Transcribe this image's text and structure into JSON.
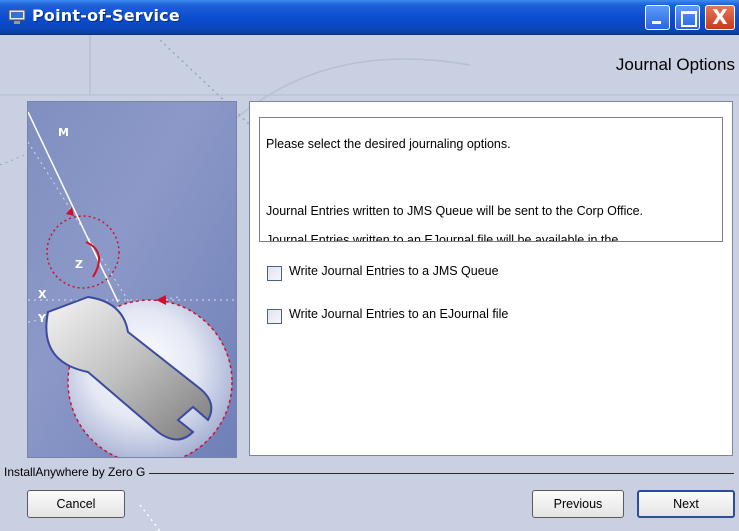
{
  "window": {
    "title": "Point-of-Service",
    "controls": {
      "minimize": "minimize",
      "maximize": "maximize",
      "close": "X"
    }
  },
  "header": {
    "title": "Journal Options"
  },
  "message": {
    "lines": [
      "Please select the desired journaling options.",
      "Journal Entries written to JMS Queue will be sent to the Corp Office.",
      "Journal Entries written to an EJournal file will be available in the"
    ]
  },
  "options": [
    {
      "label": "Write Journal Entries to a JMS Queue",
      "checked": false
    },
    {
      "label": "Write Journal Entries to an EJournal file",
      "checked": false
    }
  ],
  "side_panel": {
    "axis_labels": [
      "M",
      "Z",
      "X",
      "Y"
    ]
  },
  "footer": {
    "vendor": "InstallAnywhere by Zero G",
    "cancel_label": "Cancel",
    "previous_label": "Previous",
    "next_label": "Next"
  },
  "colors": {
    "titlebar": "#0a4ccf",
    "background": "#c9d0e2",
    "panel_blue": "#7f8fbf",
    "close_red": "#c9391a",
    "accent_red": "#d0102a"
  }
}
